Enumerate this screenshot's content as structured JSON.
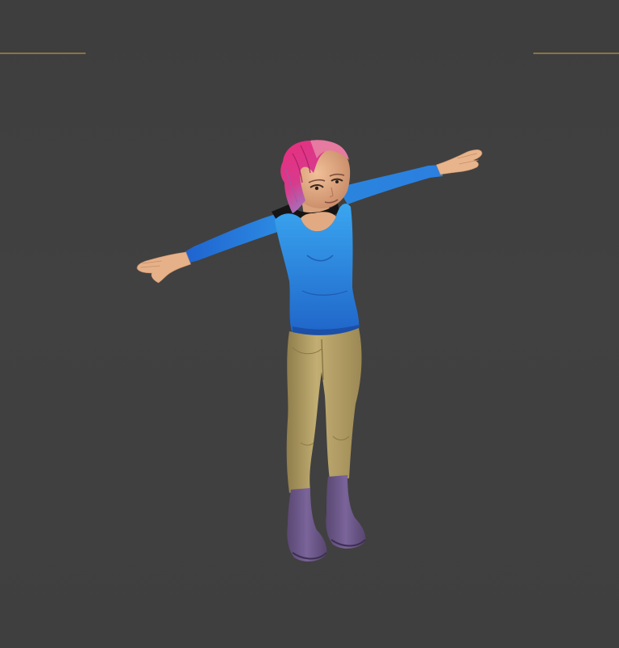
{
  "viewport": {
    "background_color": "#434343",
    "safe_frame_color": "#8a7440"
  },
  "character": {
    "hair_color": "#e0327a",
    "shirt_color": "#2f8fe0",
    "pants_color": "#b9a46b",
    "boots_color": "#6c5788",
    "skin_color": "#e9b48c",
    "collar_color": "#111111"
  }
}
